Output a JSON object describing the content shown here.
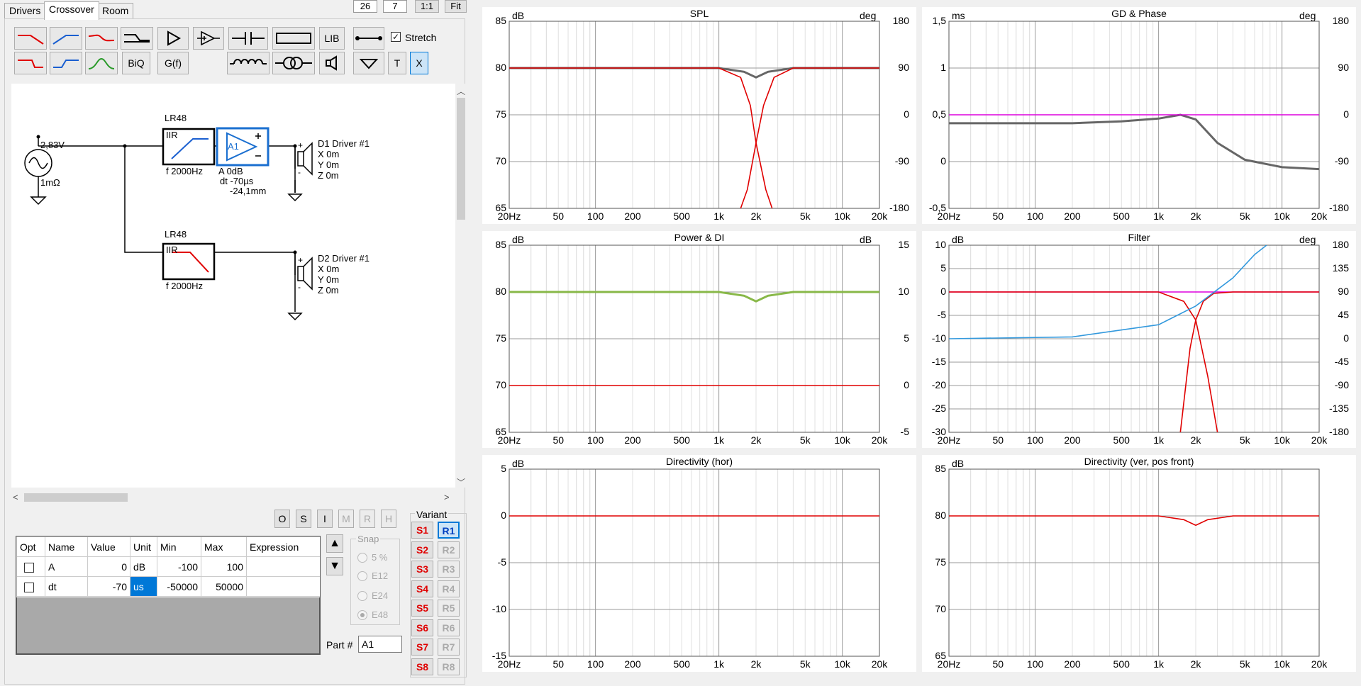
{
  "tabs": [
    "Drivers",
    "Crossover",
    "Room"
  ],
  "top_controls": {
    "box1": "26",
    "box2": "7",
    "btn_ratio": "1:1",
    "btn_fit": "Fit"
  },
  "toolbar": {
    "lib": "LIB",
    "biq": "BiQ",
    "gf": "G(f)",
    "t": "T",
    "x": "X",
    "stretch_label": "Stretch",
    "stretch_checked": true
  },
  "schematic": {
    "source": {
      "voltage": "2,83V",
      "impedance": "1mΩ"
    },
    "filter1": {
      "name": "LR48",
      "type": "IIR",
      "freq": "f  2000Hz"
    },
    "filter2": {
      "name": "LR48",
      "type": "IIR",
      "freq": "f  2000Hz"
    },
    "amp": {
      "label": "A1",
      "gain": "A  0dB",
      "delay": "dt -70µs",
      "distance": "-24,1mm"
    },
    "driver1": {
      "name": "D1 Driver #1",
      "x": "X 0m",
      "y": "Y 0m",
      "z": "Z 0m"
    },
    "driver2": {
      "name": "D2 Driver #1",
      "x": "X 0m",
      "y": "Y 0m",
      "z": "Z 0m"
    }
  },
  "mode_buttons": [
    "O",
    "S",
    "I",
    "M",
    "R",
    "H"
  ],
  "params": {
    "headers": [
      "Opt",
      "Name",
      "Value",
      "Unit",
      "Min",
      "Max",
      "Expression"
    ],
    "rows": [
      {
        "name": "A",
        "value": "0",
        "unit": "dB",
        "min": "-100",
        "max": "100",
        "expr": ""
      },
      {
        "name": "dt",
        "value": "-70",
        "unit": "us",
        "min": "-50000",
        "max": "50000",
        "expr": ""
      }
    ]
  },
  "snap": {
    "label": "Snap",
    "options": [
      "5 %",
      "E12",
      "E24",
      "E48"
    ],
    "selected": "E48"
  },
  "variant": {
    "label": "Variant",
    "s": [
      "S1",
      "S2",
      "S3",
      "S4",
      "S5",
      "S6",
      "S7",
      "S8"
    ],
    "r": [
      "R1",
      "R2",
      "R3",
      "R4",
      "R5",
      "R6",
      "R7",
      "R8"
    ],
    "active_r": "R1"
  },
  "part": {
    "label": "Part #",
    "value": "A1"
  },
  "x_ticks": [
    "20Hz",
    "50",
    "100",
    "200",
    "500",
    "1k",
    "2k",
    "5k",
    "10k",
    "20k"
  ],
  "chart_data": [
    {
      "type": "line",
      "title": "SPL",
      "ylabel": "dB",
      "y2label": "deg",
      "yticks": [
        "85",
        "80",
        "75",
        "70",
        "65"
      ],
      "y2ticks": [
        "180",
        "90",
        "0",
        "-90",
        "-180"
      ],
      "ylim": [
        65,
        85
      ],
      "y2lim": [
        -180,
        180
      ],
      "series": [
        {
          "color": "#666666",
          "x": [
            20,
            1000,
            1600,
            2000,
            2500,
            4000,
            20000
          ],
          "y": [
            80,
            80,
            79.6,
            79,
            79.6,
            80,
            80
          ]
        },
        {
          "color": "#e00000",
          "x": [
            20,
            1000,
            1500,
            1800,
            2000,
            2400,
            2700
          ],
          "y": [
            80,
            80,
            79,
            76,
            72,
            67,
            65
          ]
        },
        {
          "color": "#e00000",
          "x": [
            1500,
            1700,
            2000,
            2300,
            2800,
            4000,
            20000
          ],
          "y": [
            65,
            67,
            72,
            76,
            79,
            80,
            80
          ]
        }
      ]
    },
    {
      "type": "line",
      "title": "GD & Phase",
      "ylabel": "ms",
      "y2label": "deg",
      "yticks": [
        "1,5",
        "1",
        "0,5",
        "0",
        "-0,5"
      ],
      "y2ticks": [
        "180",
        "90",
        "0",
        "-90",
        "-180"
      ],
      "ylim": [
        -0.5,
        1.5
      ],
      "y2lim": [
        -180,
        180
      ],
      "series": [
        {
          "color": "#666666",
          "x": [
            20,
            200,
            500,
            1000,
            1500,
            2000,
            3000,
            5000,
            10000,
            20000
          ],
          "y": [
            0.41,
            0.41,
            0.43,
            0.46,
            0.5,
            0.45,
            0.2,
            0.02,
            -0.06,
            -0.08
          ]
        },
        {
          "color": "#dd00dd",
          "x": [
            20,
            20000
          ],
          "y": [
            0.5,
            0.5
          ]
        }
      ]
    },
    {
      "type": "line",
      "title": "Power & DI",
      "ylabel": "dB",
      "y2label": "dB",
      "yticks": [
        "85",
        "80",
        "75",
        "70",
        "65"
      ],
      "y2ticks": [
        "15",
        "10",
        "5",
        "0",
        "-5"
      ],
      "ylim": [
        65,
        85
      ],
      "y2lim": [
        -5,
        15
      ],
      "series": [
        {
          "color": "#88b848",
          "x": [
            20,
            1000,
            1600,
            2000,
            2500,
            4000,
            20000
          ],
          "y": [
            80,
            80,
            79.6,
            79,
            79.6,
            80,
            80
          ]
        },
        {
          "color": "#e00000",
          "x": [
            20,
            20000
          ],
          "y": [
            70,
            70
          ]
        }
      ]
    },
    {
      "type": "line",
      "title": "Filter",
      "ylabel": "dB",
      "y2label": "deg",
      "yticks": [
        "10",
        "5",
        "0",
        "-5",
        "-10",
        "-15",
        "-20",
        "-25",
        "-30"
      ],
      "y2ticks": [
        "180",
        "135",
        "90",
        "45",
        "0",
        "-45",
        "-90",
        "-135",
        "-180"
      ],
      "ylim": [
        -30,
        10
      ],
      "y2lim": [
        -180,
        180
      ],
      "series": [
        {
          "color": "#dd00dd",
          "x": [
            20,
            20000
          ],
          "y": [
            0,
            0
          ]
        },
        {
          "color": "#e00000",
          "x": [
            1500,
            1800,
            2000,
            2300,
            2800,
            4000,
            20000
          ],
          "y": [
            -30,
            -12,
            -6,
            -2,
            -0.3,
            0,
            0
          ]
        },
        {
          "color": "#e00000",
          "x": [
            20,
            1000,
            1600,
            2000,
            2500,
            3000
          ],
          "y": [
            0,
            0,
            -2,
            -6,
            -18,
            -30
          ]
        },
        {
          "color": "#3399dd",
          "x": [
            20,
            200,
            1000,
            2000,
            4000,
            6000,
            7500
          ],
          "y": [
            -10,
            -9.6,
            -7,
            -3,
            3,
            8,
            10
          ]
        }
      ]
    },
    {
      "type": "line",
      "title": "Directivity (hor)",
      "ylabel": "dB",
      "yticks": [
        "5",
        "0",
        "-5",
        "-10",
        "-15"
      ],
      "ylim": [
        -15,
        5
      ],
      "series": [
        {
          "color": "#e00000",
          "x": [
            20,
            20000
          ],
          "y": [
            0,
            0
          ]
        }
      ]
    },
    {
      "type": "line",
      "title": "Directivity (ver, pos front)",
      "ylabel": "dB",
      "yticks": [
        "85",
        "80",
        "75",
        "70",
        "65"
      ],
      "ylim": [
        65,
        85
      ],
      "series": [
        {
          "color": "#e00000",
          "x": [
            20,
            1000,
            1600,
            2000,
            2500,
            4000,
            20000
          ],
          "y": [
            80,
            80,
            79.6,
            79,
            79.6,
            80,
            80
          ]
        }
      ]
    }
  ]
}
